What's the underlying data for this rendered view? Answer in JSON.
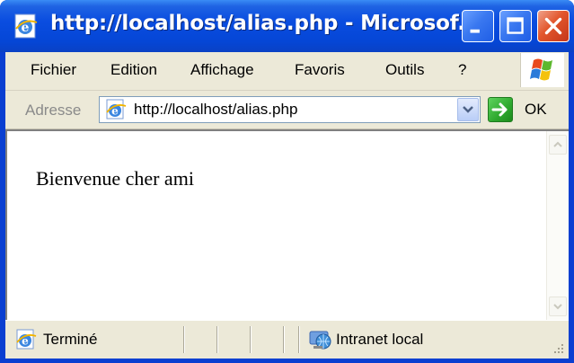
{
  "window": {
    "title": "http://localhost/alias.php - Microsof...",
    "title_bar_color": "#0a4de0",
    "close_color": "#e2562c"
  },
  "controls": {
    "minimize_icon": "minimize-icon",
    "maximize_icon": "maximize-icon",
    "close_icon": "close-icon"
  },
  "menu": {
    "items": [
      "Fichier",
      "Edition",
      "Affichage",
      "Favoris",
      "Outils",
      "?"
    ],
    "logo_icon": "windows-logo-icon"
  },
  "address_bar": {
    "label": "Adresse",
    "url": "http://localhost/alias.php",
    "go_label": "OK",
    "page_icon": "ie-page-icon",
    "dropdown_icon": "chevron-down-icon",
    "go_icon": "go-arrow-icon"
  },
  "page": {
    "text": "Bienvenue cher ami"
  },
  "status_bar": {
    "status": "Terminé",
    "zone": "Intranet local",
    "status_icon": "ie-page-icon",
    "zone_icon": "intranet-globe-icon"
  }
}
